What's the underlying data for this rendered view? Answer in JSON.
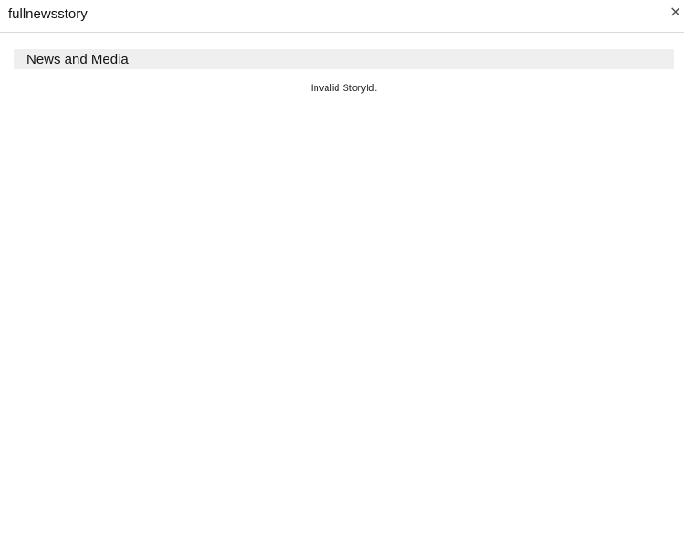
{
  "dialog": {
    "title": "fullnewsstory",
    "close_label": "×",
    "close_icon": "close-icon"
  },
  "section": {
    "title": "News and Media"
  },
  "content": {
    "message": "Invalid StoryId."
  }
}
